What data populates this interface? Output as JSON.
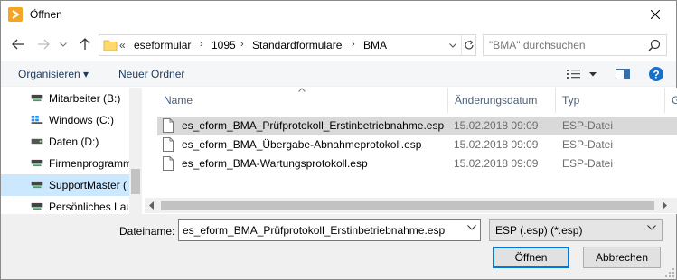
{
  "window": {
    "title": "Öffnen"
  },
  "nav": {
    "back_icon": "arrow-left-icon",
    "forward_icon": "arrow-right-icon",
    "recent_icon": "chevron-down-icon",
    "up_icon": "arrow-up-icon"
  },
  "address": {
    "overflow": "«",
    "crumbs": [
      "eseformular",
      "1095",
      "Standardformulare",
      "BMA"
    ]
  },
  "search": {
    "placeholder": "\"BMA\" durchsuchen"
  },
  "toolbar": {
    "organize_label": "Organisieren ▾",
    "new_folder_label": "Neuer Ordner"
  },
  "sidebar": {
    "items": [
      {
        "label": "Mitarbeiter (B:)"
      },
      {
        "label": "Windows (C:)"
      },
      {
        "label": "Daten (D:)"
      },
      {
        "label": "Firmenprogramm"
      },
      {
        "label": "SupportMaster ("
      },
      {
        "label": "Persönliches Lau"
      }
    ]
  },
  "columns": {
    "name": "Name",
    "date": "Änderungsdatum",
    "type": "Typ",
    "size": "G"
  },
  "files": [
    {
      "name": "es_eform_BMA_Prüfprotokoll_Erstinbetriebnahme.esp",
      "date": "15.02.2018 09:09",
      "type": "ESP-Datei"
    },
    {
      "name": "es_eform_BMA_Übergabe-Abnahmeprotokoll.esp",
      "date": "15.02.2018 09:09",
      "type": "ESP-Datei"
    },
    {
      "name": "es_eform_BMA-Wartungsprotokoll.esp",
      "date": "15.02.2018 09:09",
      "type": "ESP-Datei"
    }
  ],
  "footer": {
    "filename_label": "Dateiname:",
    "filename_value": "es_eform_BMA_Prüfprotokoll_Erstinbetriebnahme.esp",
    "filetype_value": "ESP (.esp) (*.esp)",
    "open_label": "Öffnen",
    "cancel_label": "Abbrechen"
  },
  "colors": {
    "accent": "#0078d7",
    "selected_sidebar": "#cce8ff",
    "selected_row": "#d9d9d9",
    "footer_bg": "#f0f0f0"
  }
}
